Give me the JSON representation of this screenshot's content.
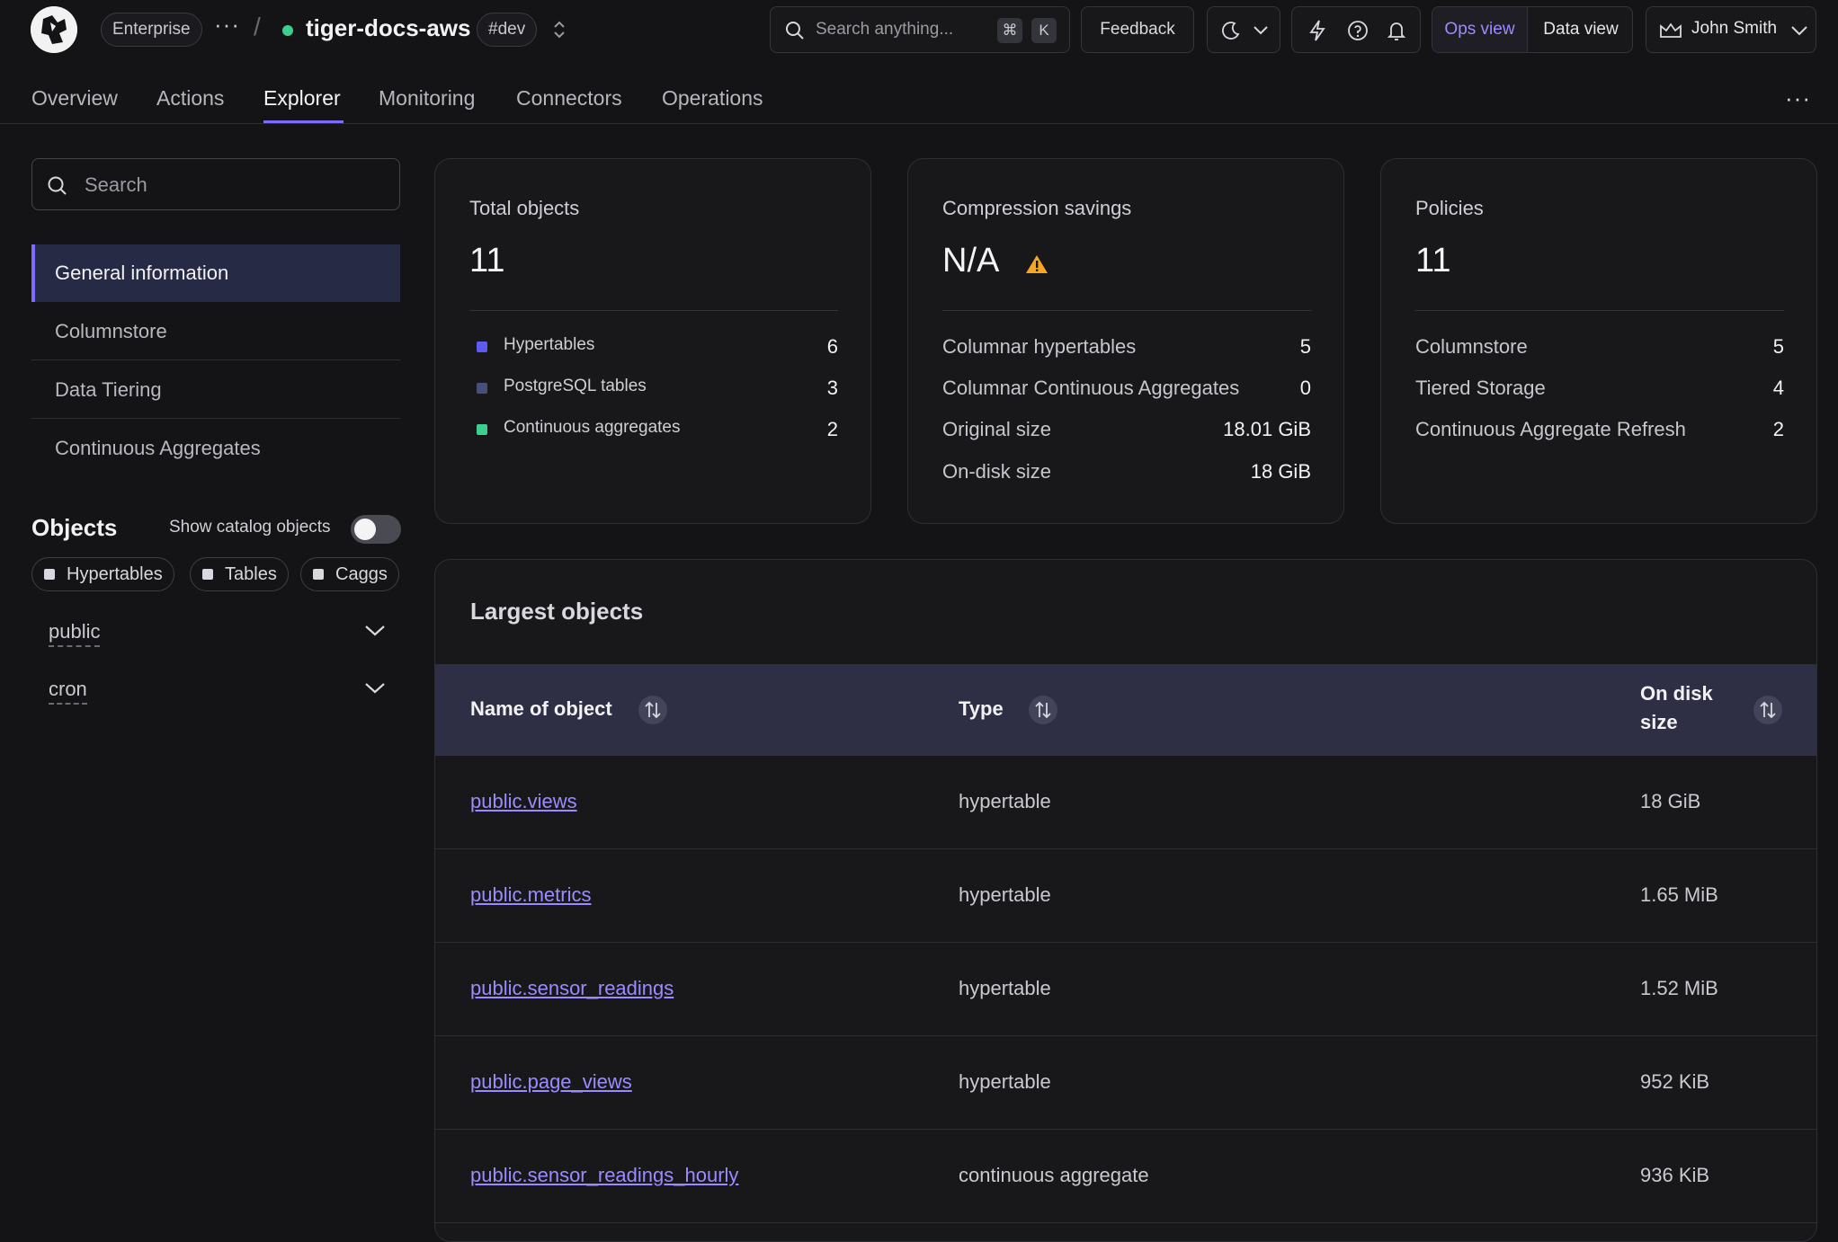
{
  "header": {
    "plan": "Enterprise",
    "service_name": "tiger-docs-aws",
    "env": "#dev",
    "search_placeholder": "Search anything...",
    "kbd_meta": "⌘",
    "kbd_key": "K",
    "feedback": "Feedback",
    "ops_view": "Ops view",
    "data_view": "Data view",
    "user_name": "John Smith",
    "status_color": "#3ecf8e",
    "accent_color": "#7c6cff"
  },
  "tabs": [
    {
      "label": "Overview"
    },
    {
      "label": "Actions"
    },
    {
      "label": "Explorer"
    },
    {
      "label": "Monitoring"
    },
    {
      "label": "Connectors"
    },
    {
      "label": "Operations"
    }
  ],
  "sidebar": {
    "search_placeholder": "Search",
    "items": [
      {
        "label": "General information"
      },
      {
        "label": "Columnstore"
      },
      {
        "label": "Data Tiering"
      },
      {
        "label": "Continuous Aggregates"
      }
    ],
    "objects_title": "Objects",
    "show_catalog_label": "Show catalog objects",
    "filters": [
      {
        "label": "Hypertables"
      },
      {
        "label": "Tables"
      },
      {
        "label": "Caggs"
      }
    ],
    "schemas": [
      {
        "label": "public"
      },
      {
        "label": "cron"
      }
    ]
  },
  "cards": {
    "total": {
      "title": "Total objects",
      "value": "11",
      "rows": [
        {
          "label": "Hypertables",
          "value": "6",
          "color": "#5b5bf0"
        },
        {
          "label": "PostgreSQL tables",
          "value": "3",
          "color": "#4a4e7a"
        },
        {
          "label": "Continuous aggregates",
          "value": "2",
          "color": "#3ecf8e"
        }
      ]
    },
    "compression": {
      "title": "Compression savings",
      "value": "N/A",
      "warning_color": "#f5a623",
      "rows": [
        {
          "label": "Columnar hypertables",
          "value": "5"
        },
        {
          "label": "Columnar Continuous Aggregates",
          "value": "0"
        },
        {
          "label": "Original size",
          "value": "18.01 GiB"
        },
        {
          "label": "On-disk size",
          "value": "18 GiB"
        }
      ]
    },
    "policies": {
      "title": "Policies",
      "value": "11",
      "rows": [
        {
          "label": "Columnstore",
          "value": "5"
        },
        {
          "label": "Tiered Storage",
          "value": "4"
        },
        {
          "label": "Continuous Aggregate Refresh",
          "value": "2"
        }
      ]
    }
  },
  "largest": {
    "title": "Largest objects",
    "columns": {
      "name": "Name of object",
      "type": "Type",
      "size_line1": "On disk",
      "size_line2": "size"
    },
    "rows": [
      {
        "name": "public.views",
        "type": "hypertable",
        "size": "18 GiB"
      },
      {
        "name": "public.metrics",
        "type": "hypertable",
        "size": "1.65 MiB"
      },
      {
        "name": "public.sensor_readings",
        "type": "hypertable",
        "size": "1.52 MiB"
      },
      {
        "name": "public.page_views",
        "type": "hypertable",
        "size": "952 KiB"
      },
      {
        "name": "public.sensor_readings_hourly",
        "type": "continuous aggregate",
        "size": "936 KiB"
      }
    ]
  }
}
